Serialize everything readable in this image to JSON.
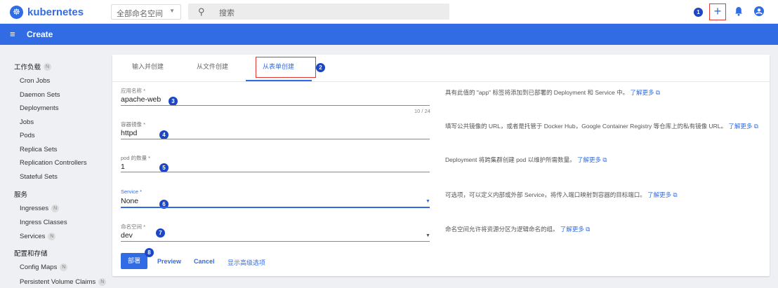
{
  "app": {
    "logo_glyph": "☸",
    "name": "kubernetes"
  },
  "topbar": {
    "namespace_selector": "全部命名空间",
    "search_placeholder": "搜索",
    "add_glyph": "+"
  },
  "annotations": [
    "1",
    "2",
    "3",
    "4",
    "5",
    "6",
    "7",
    "8"
  ],
  "header": {
    "title": "Create",
    "menu_glyph": "≡"
  },
  "sidebar": {
    "badge": "N",
    "sections": [
      {
        "label": "工作负载",
        "badge": true,
        "items": [
          {
            "label": "Cron Jobs",
            "badge": false
          },
          {
            "label": "Daemon Sets",
            "badge": false
          },
          {
            "label": "Deployments",
            "badge": false
          },
          {
            "label": "Jobs",
            "badge": false
          },
          {
            "label": "Pods",
            "badge": false
          },
          {
            "label": "Replica Sets",
            "badge": false
          },
          {
            "label": "Replication Controllers",
            "badge": false
          },
          {
            "label": "Stateful Sets",
            "badge": false
          }
        ]
      },
      {
        "label": "服务",
        "badge": false,
        "items": [
          {
            "label": "Ingresses",
            "badge": true
          },
          {
            "label": "Ingress Classes",
            "badge": false
          },
          {
            "label": "Services",
            "badge": true
          }
        ]
      },
      {
        "label": "配置和存储",
        "badge": false,
        "items": [
          {
            "label": "Config Maps",
            "badge": true
          },
          {
            "label": "Persistent Volume Claims",
            "badge": true
          }
        ]
      }
    ]
  },
  "tabs": [
    {
      "label": "输入并创建",
      "active": false
    },
    {
      "label": "从文件创建",
      "active": false
    },
    {
      "label": "从表单创建",
      "active": true
    }
  ],
  "form": {
    "app_name": {
      "label": "应用名称 *",
      "value": "apache-web",
      "counter": "10 / 24",
      "help": "具有此值的 \"app\" 标签将添加到已部署的 Deployment 和 Service 中。",
      "link": "了解更多"
    },
    "image": {
      "label": "容器镜像 *",
      "value": "httpd",
      "help": "填写公共镜像的 URL，或者是托管于 Docker Hub，Google Container Registry 等仓库上的私有镜像 URL。",
      "link": "了解更多"
    },
    "pods": {
      "label": "pod 的数量 *",
      "value": "1",
      "help": "Deployment 将跨集群创建 pod 以维护所需数量。",
      "link": "了解更多"
    },
    "service": {
      "label": "Service *",
      "value": "None",
      "help": "可选项，可以定义内部或外部 Service，将传入端口映射到容器的目标端口。",
      "link": "了解更多"
    },
    "namespace": {
      "label": "命名空间 *",
      "value": "dev",
      "help": "命名空间允许将资源分区为逻辑命名的组。",
      "link": "了解更多"
    }
  },
  "actions": {
    "deploy": "部署",
    "preview": "Preview",
    "cancel": "Cancel",
    "advanced": "显示高级选项"
  },
  "glyphs": {
    "search_icon": "⚲",
    "caret_down": "▼",
    "external_link": "⧉"
  },
  "colors": {
    "brand": "#326ce5",
    "highlight": "#e53935",
    "annotation": "#1c46c4"
  }
}
